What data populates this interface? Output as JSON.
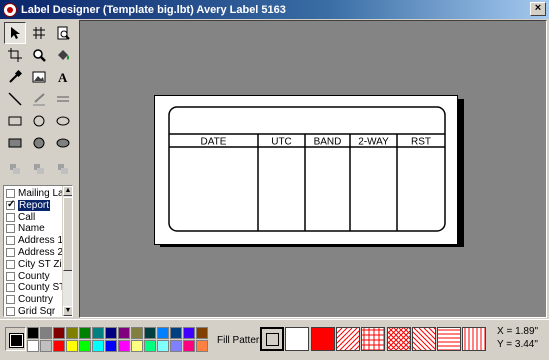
{
  "window": {
    "title": "Label Designer (Template big.lbt) Avery Label 5163",
    "close_glyph": "×"
  },
  "tools": [
    {
      "name": "pointer-tool-icon",
      "pressed": true
    },
    {
      "name": "grid-tool-icon"
    },
    {
      "name": "page-preview-tool-icon"
    },
    {
      "name": "crop-tool-icon"
    },
    {
      "name": "zoom-tool-icon"
    },
    {
      "name": "fill-bucket-tool-icon"
    },
    {
      "name": "eyedropper-tool-icon"
    },
    {
      "name": "image-tool-icon"
    },
    {
      "name": "text-tool-icon"
    },
    {
      "name": "line-tool-icon"
    },
    {
      "name": "pen-tool-icon"
    },
    {
      "name": "double-line-tool-icon"
    },
    {
      "name": "rectangle-tool-icon"
    },
    {
      "name": "ellipse-tool-icon"
    },
    {
      "name": "rounded-oval-tool-icon"
    },
    {
      "name": "filled-rectangle-tool-icon"
    },
    {
      "name": "filled-circle-tool-icon"
    },
    {
      "name": "filled-oval-tool-icon"
    },
    {
      "name": "align-left-tool-icon",
      "disabled": true
    },
    {
      "name": "align-center-tool-icon",
      "disabled": true
    },
    {
      "name": "align-right-tool-icon",
      "disabled": true
    }
  ],
  "fields": [
    {
      "label": "Mailing Lab",
      "checked": false,
      "selected": false
    },
    {
      "label": "Report",
      "checked": true,
      "selected": true
    },
    {
      "label": "Call",
      "checked": false,
      "selected": false
    },
    {
      "label": "Name",
      "checked": false,
      "selected": false
    },
    {
      "label": "Address 1",
      "checked": false,
      "selected": false
    },
    {
      "label": "Address 2",
      "checked": false,
      "selected": false
    },
    {
      "label": "City ST Zip",
      "checked": false,
      "selected": false
    },
    {
      "label": "County",
      "checked": false,
      "selected": false
    },
    {
      "label": "County ST",
      "checked": false,
      "selected": false
    },
    {
      "label": "Country",
      "checked": false,
      "selected": false
    },
    {
      "label": "Grid Sqr",
      "checked": false,
      "selected": false
    }
  ],
  "label_table": {
    "columns": [
      "DATE",
      "UTC",
      "BAND",
      "2-WAY",
      "RST"
    ]
  },
  "palette": {
    "top_row": [
      "#000000",
      "#808080",
      "#800000",
      "#808000",
      "#008000",
      "#008080",
      "#000080",
      "#800080",
      "#808040",
      "#004040",
      "#0080ff",
      "#004080",
      "#4000ff",
      "#804000"
    ],
    "bottom_row": [
      "#ffffff",
      "#c0c0c0",
      "#ff0000",
      "#ffff00",
      "#00ff00",
      "#00ffff",
      "#0000ff",
      "#ff00ff",
      "#ffff80",
      "#00ff80",
      "#80ffff",
      "#8080ff",
      "#ff0080",
      "#ff8040"
    ]
  },
  "fill_pattern": {
    "label": "Fill Pattern",
    "patterns": [
      "none-pattern",
      "white-pattern",
      "solid-red-pattern",
      "diagonal-lines-pattern",
      "grid-pattern",
      "diagonal-cross-pattern",
      "back-diagonal-pattern",
      "horizontal-lines-pattern",
      "vertical-lines-pattern"
    ],
    "color": "#ff0000"
  },
  "coords": {
    "x": "X = 1.89\"",
    "y": "Y = 3.44\""
  }
}
